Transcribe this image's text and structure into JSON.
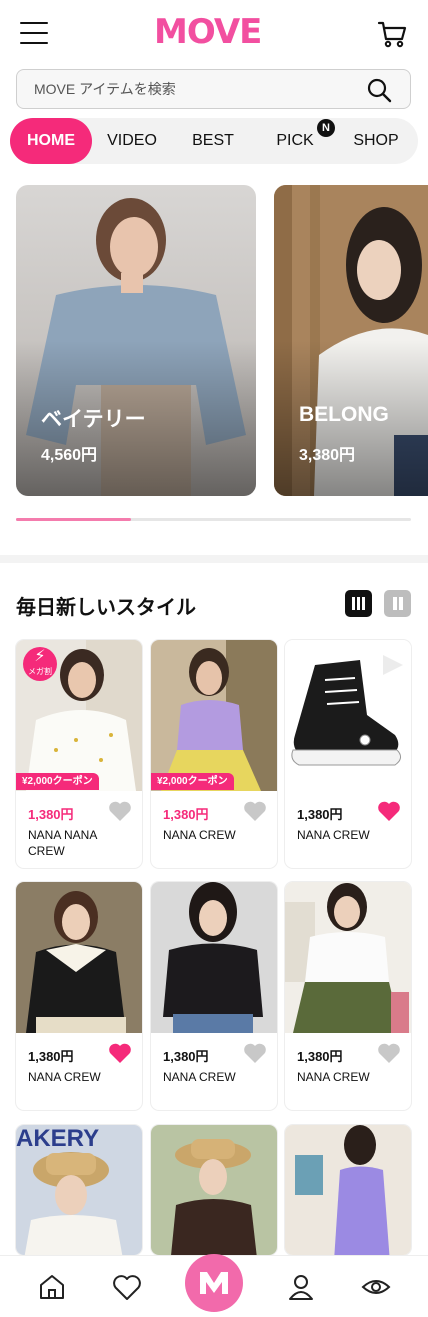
{
  "header": {
    "logo": "MOVE",
    "menu_icon": "hamburger-menu-icon",
    "cart_icon": "cart-icon"
  },
  "search": {
    "placeholder": "MOVE アイテムを検索",
    "icon": "search-icon"
  },
  "tabs": [
    {
      "label": "HOME",
      "active": true
    },
    {
      "label": "VIDEO",
      "active": false
    },
    {
      "label": "BEST",
      "active": false
    },
    {
      "label": "PICK",
      "active": false,
      "badge": "N"
    },
    {
      "label": "SHOP",
      "active": false
    }
  ],
  "banners": [
    {
      "title": "ベイテリー",
      "price": "4,560円"
    },
    {
      "title": "BELONG",
      "price": "3,380円"
    }
  ],
  "banner_progress": 0.29,
  "section": {
    "title": "毎日新しいスタイル"
  },
  "products": [
    {
      "price": "1,380円",
      "brand": "NANA NANA CREW",
      "coupon": "¥2,000クーポン",
      "mega_badge": "メガ割",
      "liked": false,
      "price_pink": true
    },
    {
      "price": "1,380円",
      "brand": "NANA CREW",
      "coupon": "¥2,000クーポン",
      "liked": false,
      "price_pink": true
    },
    {
      "price": "1,380円",
      "brand": "NANA CREW",
      "liked": true,
      "price_pink": false
    },
    {
      "price": "1,380円",
      "brand": "NANA CREW",
      "liked": true,
      "price_pink": false
    },
    {
      "price": "1,380円",
      "brand": "NANA CREW",
      "liked": false,
      "price_pink": false
    },
    {
      "price": "1,380円",
      "brand": "NANA CREW",
      "liked": false,
      "price_pink": false
    },
    {
      "partial_text": "AKERY"
    },
    {},
    {}
  ],
  "bottom_nav": [
    "home-icon",
    "heart-icon",
    "move-logo-icon",
    "user-icon",
    "eye-icon"
  ],
  "colors": {
    "brand_pink": "#f52a7a",
    "logo_pink": "#f24fa0",
    "heart_gray": "#c8c8c8"
  }
}
